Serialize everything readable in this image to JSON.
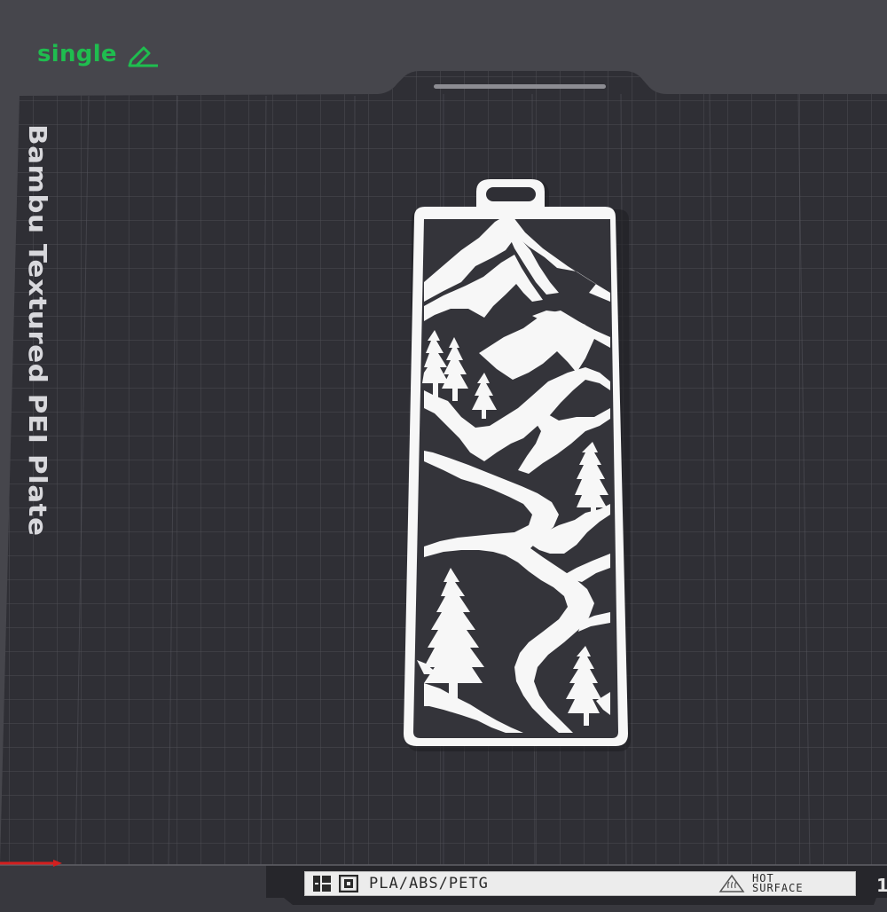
{
  "plate": {
    "label": "single",
    "edit_icon": "pencil-icon",
    "name": "Bambu Textured PEI Plate",
    "material_strip": "PLA/ABS/PETG",
    "warning_line1": "HOT",
    "warning_line2": "SURFACE",
    "warning_icon": "hot-surface-icon",
    "edge_glyph": "1"
  },
  "model": {
    "name": "mountain-bookmark",
    "color": "#ffffff"
  },
  "colors": {
    "background": "#46464c",
    "bed": "#2e2e33",
    "grid": "#4a4a50",
    "accent_green": "#1fbd4f",
    "axis_x": "#d31f1f"
  }
}
